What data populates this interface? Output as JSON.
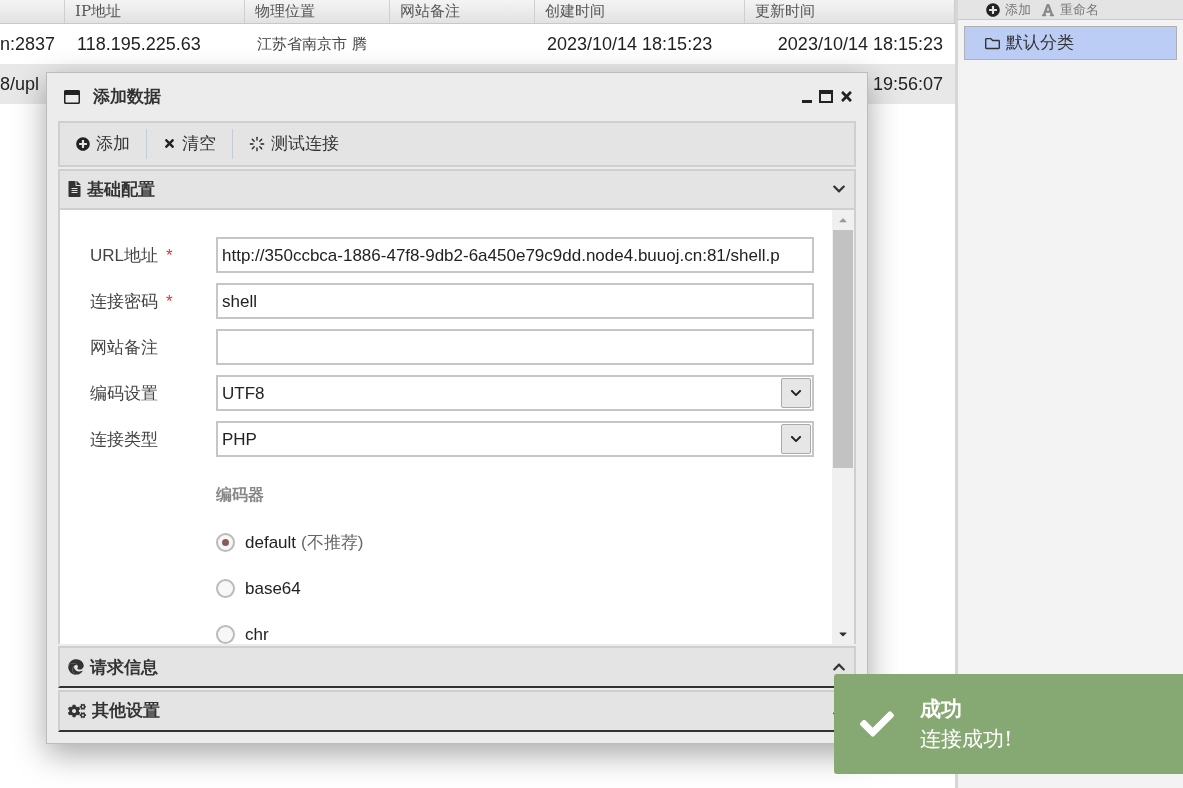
{
  "table": {
    "columns": [
      null,
      "IP地址",
      "物理位置",
      "网站备注",
      "创建时间",
      "更新时间"
    ],
    "rows": [
      {
        "cells": [
          "n:2837",
          "118.195.225.63",
          "江苏省南京市 腾",
          null,
          "2023/10/14 18:15:23",
          "2023/10/14 18:15:23"
        ],
        "selected": false
      },
      {
        "cells": [
          "8/upl",
          null,
          null,
          null,
          null,
          "19:56:07"
        ],
        "selected": true
      }
    ]
  },
  "side_panel": {
    "toolbar": [
      {
        "label": "添加",
        "kind": "add"
      },
      {
        "label": "重命名",
        "kind": "rename"
      }
    ],
    "items": [
      {
        "label": "默认分类",
        "selected": true
      }
    ]
  },
  "dialog": {
    "title": "添加数据",
    "toolbar": [
      {
        "label": "添加",
        "kind": "add"
      },
      {
        "label": "清空",
        "kind": "clear"
      },
      {
        "label": "测试连接",
        "kind": "test"
      }
    ],
    "sections": [
      {
        "title": "基础配置",
        "kind": "basic",
        "expanded": true
      },
      {
        "title": "请求信息",
        "kind": "request",
        "expanded": false
      },
      {
        "title": "其他设置",
        "kind": "other",
        "expanded": false
      }
    ],
    "fields": [
      {
        "label": "URL地址",
        "required_mark": "*",
        "kind": "text",
        "value": "http://350ccbca-1886-47f8-9db2-6a450e79c9dd.node4.buuoj.cn:81/shell.p"
      },
      {
        "label": "连接密码",
        "required_mark": "*",
        "kind": "text",
        "value": "shell"
      },
      {
        "label": "网站备注",
        "kind": "text"
      },
      {
        "label": "编码设置",
        "kind": "select",
        "value": "UTF8"
      },
      {
        "label": "连接类型",
        "kind": "select",
        "value": "PHP"
      }
    ],
    "encoder": {
      "label": "编码器",
      "options": [
        {
          "label": "default",
          "note": "(不推荐)",
          "selected": true
        },
        {
          "label": "base64",
          "selected": false
        },
        {
          "label": "chr",
          "selected": false
        }
      ]
    }
  },
  "toast": {
    "title": "成功",
    "message": "连接成功!"
  }
}
